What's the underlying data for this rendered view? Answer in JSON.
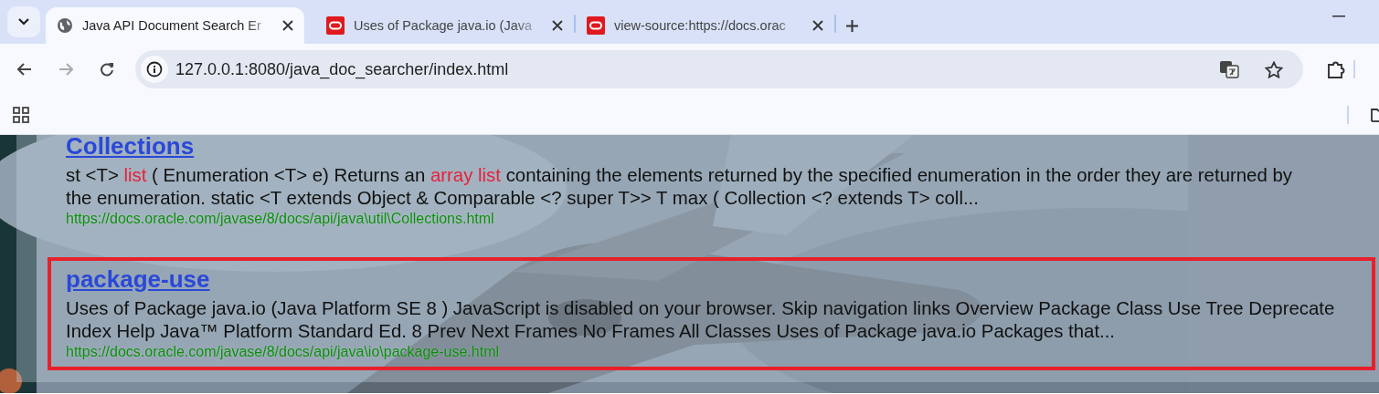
{
  "tabs": [
    {
      "title": "Java API Document Search Er",
      "kind": "globe",
      "selected": true
    },
    {
      "title": "Uses of Package java.io (Java",
      "kind": "badge",
      "selected": false
    },
    {
      "title": "view-source:https://docs.orac",
      "kind": "badge",
      "selected": false
    }
  ],
  "address_bar": {
    "url": "127.0.0.1:8080/java_doc_searcher/index.html"
  },
  "results": [
    {
      "title": "Collections",
      "selected": false,
      "lines": [
        [
          {
            "text": "st <T> "
          },
          {
            "text": "list",
            "kind": "highlight"
          },
          {
            "text": " ( Enumeration <T> e) Returns an "
          },
          {
            "text": "array list",
            "kind": "highlight"
          },
          {
            "text": " containing the elements returned by the specified enumeration in the order they are returned by"
          }
        ],
        [
          {
            "text": "the enumeration. static <T extends Object & Comparable <? super T>> T max ( Collection <? extends T> coll..."
          }
        ]
      ],
      "url": "https://docs.oracle.com/javase/8/docs/api/java\\util\\Collections.html"
    },
    {
      "title": "package-use",
      "selected": true,
      "lines": [
        [
          {
            "text": "Uses of Package java.io (Java Platform SE 8 ) JavaScript is disabled on your browser. Skip navigation links Overview Package Class Use Tree Deprecate"
          }
        ],
        [
          {
            "text": "Index Help Java™ Platform Standard Ed. 8 Prev Next Frames No Frames All Classes Uses of Package java.io Packages that..."
          }
        ]
      ],
      "url": "https://docs.oracle.com/javase/8/docs/api/java\\io\\package-use.html"
    }
  ]
}
